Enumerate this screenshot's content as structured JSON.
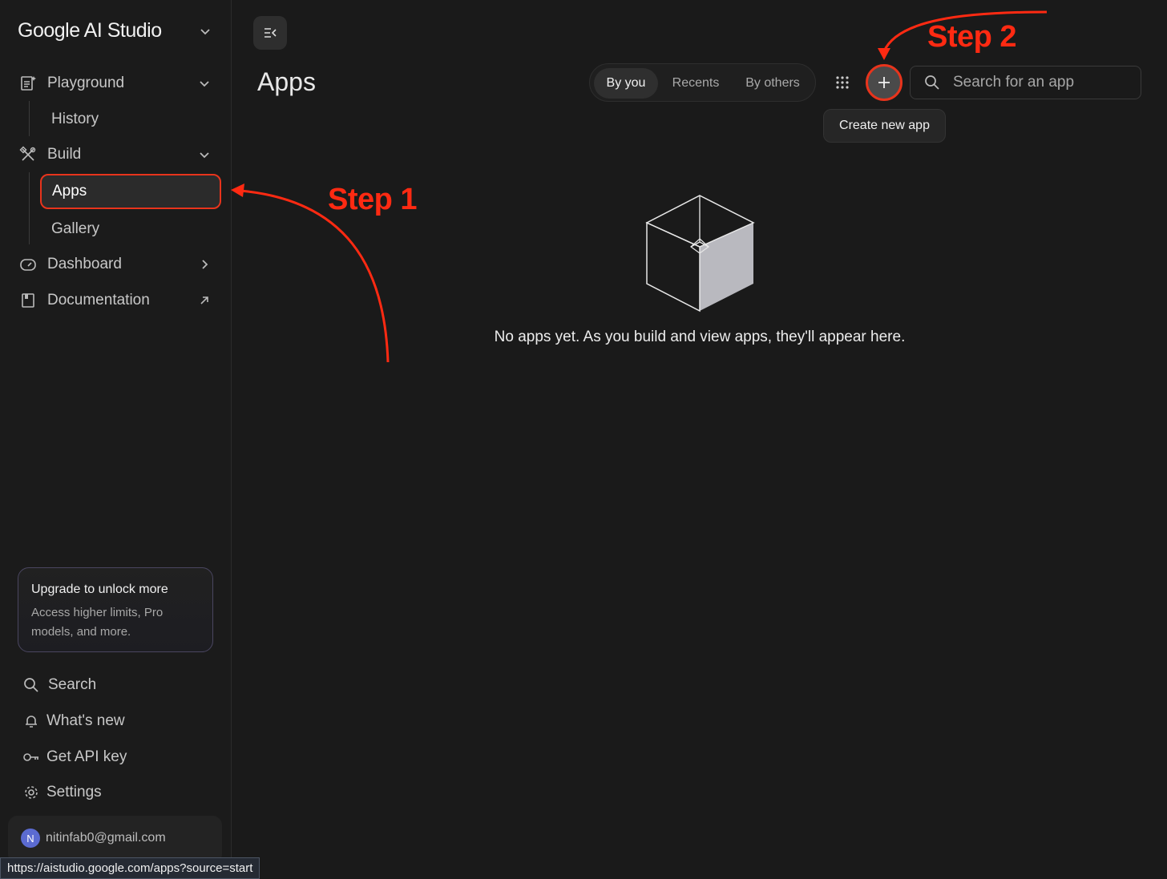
{
  "app": {
    "brand": "Google AI Studio"
  },
  "sidebar": {
    "nav": [
      {
        "label": "Playground",
        "icon": "playground-icon",
        "trailing": "chevron-down-icon"
      },
      {
        "label": "History"
      },
      {
        "label": "Build",
        "icon": "build-icon",
        "trailing": "chevron-down-icon"
      },
      {
        "label": "Apps",
        "active": true
      },
      {
        "label": "Gallery"
      },
      {
        "label": "Dashboard",
        "icon": "dashboard-icon",
        "trailing": "chevron-right-icon"
      },
      {
        "label": "Documentation",
        "icon": "book-icon",
        "trailing": "external-link-icon"
      }
    ],
    "upgrade": {
      "title": "Upgrade to unlock more",
      "text": "Access higher limits, Pro models, and more."
    },
    "bottom": [
      {
        "label": "Search",
        "icon": "search-icon"
      },
      {
        "label": "What's new",
        "icon": "bell-icon"
      },
      {
        "label": "Get API key",
        "icon": "key-icon"
      },
      {
        "label": "Settings",
        "icon": "gear-icon"
      }
    ],
    "account": {
      "initial": "N",
      "email": "nitinfab0@gmail.com"
    }
  },
  "status_url": "https://aistudio.google.com/apps?source=start",
  "main": {
    "title": "Apps",
    "filters": [
      "By you",
      "Recents",
      "By others"
    ],
    "selected_filter": "By you",
    "search_placeholder": "Search for an app",
    "tooltip": "Create new app",
    "empty_message": "No apps yet. As you build and view apps, they'll appear here."
  },
  "annotations": {
    "step1": "Step 1",
    "step2": "Step 2",
    "color": "#ff2a12"
  },
  "colors": {
    "background": "#1a1a1a",
    "accent_outline": "#e8341c",
    "avatar": "#5b6bd1"
  }
}
